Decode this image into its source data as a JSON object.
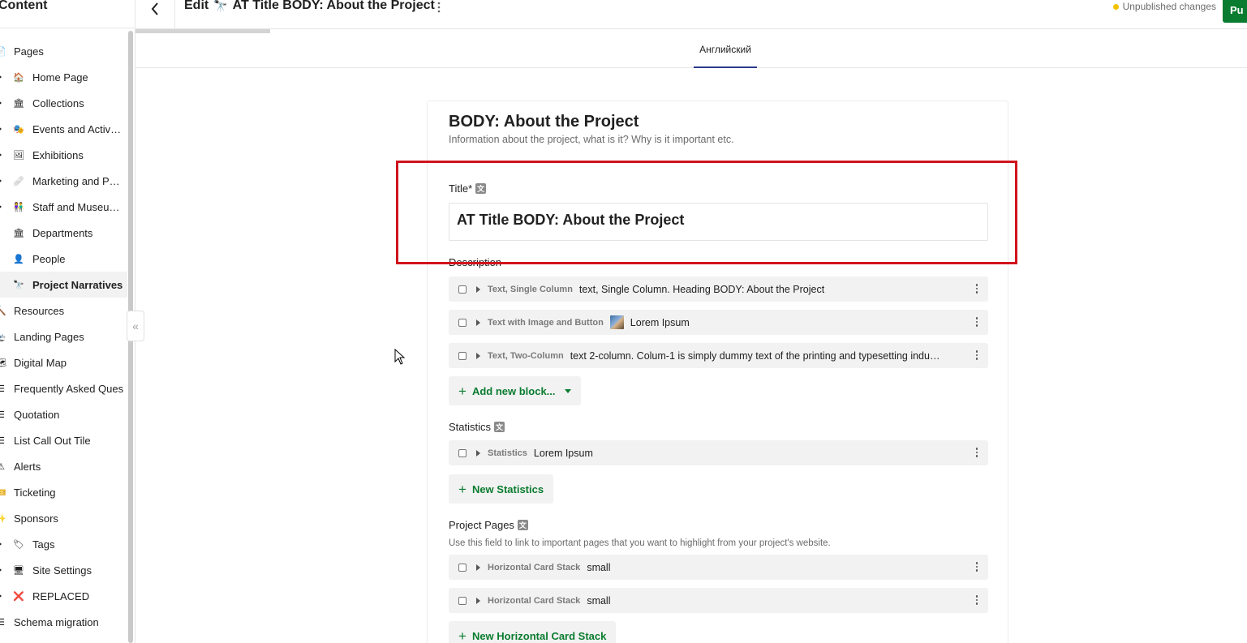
{
  "sidebar": {
    "title": "Content",
    "items": [
      {
        "label": "Pages",
        "icon": "page-icon",
        "glyph": "📄",
        "level": 0,
        "caret": false
      },
      {
        "label": "Home Page",
        "icon": "house-icon",
        "glyph": "🏠",
        "level": 1,
        "caret": true
      },
      {
        "label": "Collections",
        "icon": "museum-icon",
        "glyph": "🏛",
        "level": 1,
        "caret": true
      },
      {
        "label": "Events and Activ…",
        "icon": "theater-masks-icon",
        "glyph": "🎭",
        "level": 1,
        "caret": true
      },
      {
        "label": "Exhibitions",
        "icon": "gallery-icon",
        "glyph": "🖼",
        "level": 1,
        "caret": true
      },
      {
        "label": "Marketing and P…",
        "icon": "bandage-icon",
        "glyph": "🩹",
        "level": 1,
        "caret": true
      },
      {
        "label": "Staff and Museu…",
        "icon": "people-icon",
        "glyph": "👫",
        "level": 1,
        "caret": true
      },
      {
        "label": "Departments",
        "icon": "museum-icon",
        "glyph": "🏛",
        "level": 1,
        "caret": false
      },
      {
        "label": "People",
        "icon": "person-icon",
        "glyph": "👤",
        "level": 1,
        "caret": false
      },
      {
        "label": "Project Narratives",
        "icon": "telescope-icon",
        "glyph": "🔭",
        "level": 1,
        "caret": false,
        "active": true
      },
      {
        "label": "Resources",
        "icon": "hammer-icon",
        "glyph": "🔨",
        "level": 0,
        "caret": false
      },
      {
        "label": "Landing Pages",
        "icon": "plane-icon",
        "glyph": "🛬",
        "level": 0,
        "caret": false
      },
      {
        "label": "Digital Map",
        "icon": "map-icon",
        "glyph": "🗺",
        "level": 0,
        "caret": false
      },
      {
        "label": "Frequently Asked Ques",
        "icon": "list-icon",
        "glyph": "☰",
        "level": 0,
        "caret": false
      },
      {
        "label": "Quotation",
        "icon": "list-icon",
        "glyph": "☰",
        "level": 0,
        "caret": false
      },
      {
        "label": "List Call Out Tile",
        "icon": "list-icon",
        "glyph": "☰",
        "level": 0,
        "caret": false
      },
      {
        "label": "Alerts",
        "icon": "warning-icon",
        "glyph": "⚠",
        "level": 0,
        "caret": false
      },
      {
        "label": "Ticketing",
        "icon": "ticket-icon",
        "glyph": "🎫",
        "level": 0,
        "caret": false
      },
      {
        "label": "Sponsors",
        "icon": "sparkle-icon",
        "glyph": "✨",
        "level": 0,
        "caret": false
      },
      {
        "label": "Tags",
        "icon": "tag-icon",
        "glyph": "🏷",
        "level": 1,
        "caret": true
      },
      {
        "label": "Site Settings",
        "icon": "monitor-icon",
        "glyph": "🖥",
        "level": 1,
        "caret": true
      },
      {
        "label": "REPLACED",
        "icon": "x-mark-icon",
        "glyph": "❌",
        "level": 1,
        "caret": true
      },
      {
        "label": "Schema migration",
        "icon": "list-icon",
        "glyph": "☰",
        "level": 0,
        "caret": false
      }
    ],
    "collapse_glyph": "«"
  },
  "header": {
    "edit_label": "Edit",
    "doc_icon": "🔭",
    "doc_title": "AT Title BODY: About the Project",
    "status": "Unpublished changes",
    "publish_label": "Pu"
  },
  "tabs": [
    {
      "label": "Английский",
      "active": true
    }
  ],
  "form": {
    "heading": "BODY: About the Project",
    "subheading": "Information about the project, what is it? Why is it important etc.",
    "title_label": "Title*",
    "title_value": "AT Title BODY: About the Project",
    "description_label": "Description",
    "description_blocks": [
      {
        "type": "Text, Single Column",
        "summary": "text, Single Column. Heading BODY: About the Project",
        "thumb": false
      },
      {
        "type": "Text with Image and Button",
        "summary": "Lorem Ipsum",
        "thumb": true
      },
      {
        "type": "Text, Two-Column",
        "summary": "text 2-column. Colum-1 is simply dummy text of the printing and typesetting indu…",
        "thumb": false
      }
    ],
    "add_block_label": "Add new block...",
    "statistics_label": "Statistics",
    "statistics_blocks": [
      {
        "type": "Statistics",
        "summary": "Lorem Ipsum"
      }
    ],
    "new_statistics_label": "New Statistics",
    "project_pages_label": "Project Pages",
    "project_pages_help": "Use this field to link to important pages that you want to highlight from your project's website.",
    "project_pages_blocks": [
      {
        "type": "Horizontal Card Stack",
        "summary": "small"
      },
      {
        "type": "Horizontal Card Stack",
        "summary": "small"
      }
    ],
    "new_card_stack_label": "New Horizontal Card Stack"
  },
  "colors": {
    "accent_green": "#0a7c2f",
    "tab_underline": "#2b3a8c",
    "highlight_red": "#d0141d",
    "status_dot": "#f2c200"
  }
}
